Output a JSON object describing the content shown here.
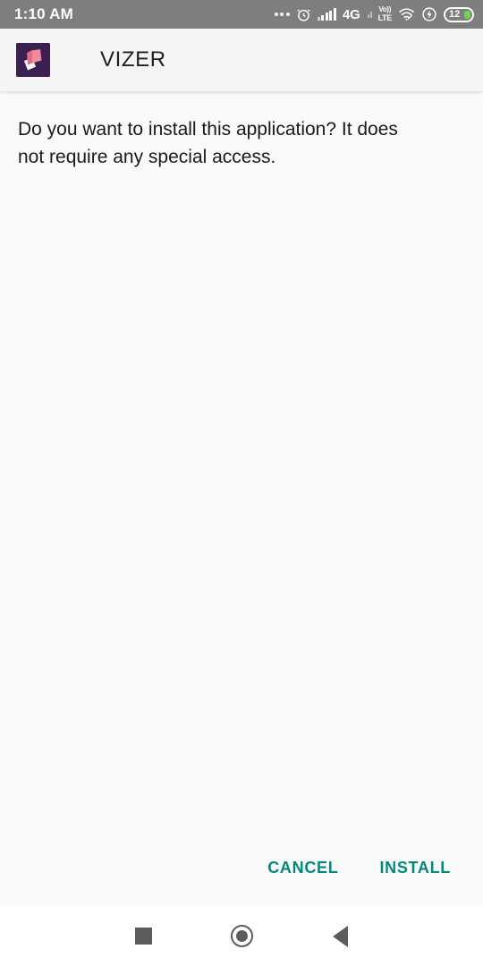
{
  "status_bar": {
    "time": "1:10 AM",
    "icons": [
      {
        "name": "more-dots-icon",
        "label": "•••"
      },
      {
        "name": "alarm-clock-icon",
        "label": "alarm"
      },
      {
        "name": "signal-bars-icon",
        "label": "signal"
      },
      {
        "name": "network-type-label",
        "label": "4G"
      },
      {
        "name": "signal-bars-secondary-icon",
        "label": "signal2"
      },
      {
        "name": "volte-icon",
        "label": "VoLTE"
      },
      {
        "name": "wifi-icon",
        "label": "wifi"
      },
      {
        "name": "flash-charging-icon",
        "label": "flash"
      },
      {
        "name": "battery-icon",
        "label": "battery"
      }
    ],
    "network_type": "4G",
    "volte_top": "Vo))",
    "volte_bottom": "LTE",
    "battery_level": "12",
    "background_color": "#7E7E7E"
  },
  "app_header": {
    "app_name": "VIZER",
    "icon_name": "vizer-app-icon",
    "icon_background": "#3B2151",
    "icon_accent": "#F2889B",
    "background_color": "#F5F5F5"
  },
  "main": {
    "message": "Do you want to install this application? It does not require any special access."
  },
  "actions": {
    "cancel_label": "CANCEL",
    "install_label": "INSTALL",
    "accent_color": "#00897B"
  },
  "nav_bar": {
    "recents_label": "recents",
    "home_label": "home",
    "back_label": "back",
    "icon_color": "#5C5C5C"
  }
}
